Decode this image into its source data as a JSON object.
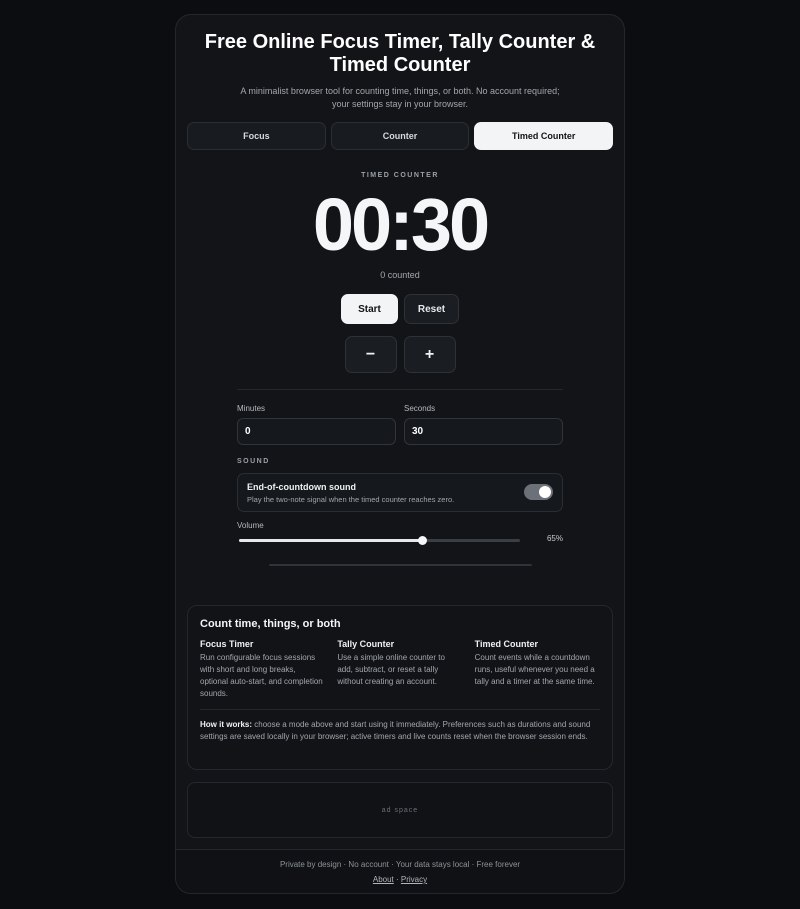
{
  "header": {
    "title": "Free Online Focus Timer, Tally Counter & Timed Counter",
    "subtitle": "A minimalist browser tool for counting time, things, or both. No account required; your settings stay in your browser."
  },
  "tabs": [
    {
      "label": "Focus",
      "active": false
    },
    {
      "label": "Counter",
      "active": false
    },
    {
      "label": "Timed Counter",
      "active": true
    }
  ],
  "timer": {
    "mode_label": "TIMED COUNTER",
    "display": "00:30",
    "counted": "0 counted"
  },
  "controls": {
    "start_label": "Start",
    "reset_label": "Reset",
    "minus_label": "−",
    "plus_label": "+"
  },
  "fields": {
    "minutes_label": "Minutes",
    "minutes_value": "0",
    "seconds_label": "Seconds",
    "seconds_value": "30"
  },
  "sound": {
    "heading": "SOUND",
    "toggle_title": "End-of-countdown sound",
    "toggle_desc": "Play the two-note signal when the timed counter reaches zero.",
    "toggle_on": true,
    "volume_label": "Volume",
    "volume_value": "65%",
    "volume_fraction": 0.65
  },
  "info": {
    "title": "Count time, things, or both",
    "columns": [
      {
        "title": "Focus Timer",
        "text": "Run configurable focus sessions with short and long breaks, optional auto-start, and completion sounds."
      },
      {
        "title": "Tally Counter",
        "text": "Use a simple online counter to add, subtract, or reset a tally without creating an account."
      },
      {
        "title": "Timed Counter",
        "text": "Count events while a countdown runs, useful whenever you need a tally and a timer at the same time."
      }
    ],
    "note_label": "How it works:",
    "note_text": " choose a mode above and start using it immediately. Preferences such as durations and sound settings are saved locally in your browser; active timers and live counts reset when the browser session ends."
  },
  "ad": {
    "label": "ad space"
  },
  "footer": {
    "text": "Private by design · No account · Your data stays local · Free forever",
    "about_label": "About",
    "separator": " · ",
    "privacy_label": "Privacy"
  },
  "colors": {
    "background": "#0b0d10",
    "card": "#121418",
    "accent_light": "#f3f4f6",
    "toggle_on": "#6b7079"
  }
}
